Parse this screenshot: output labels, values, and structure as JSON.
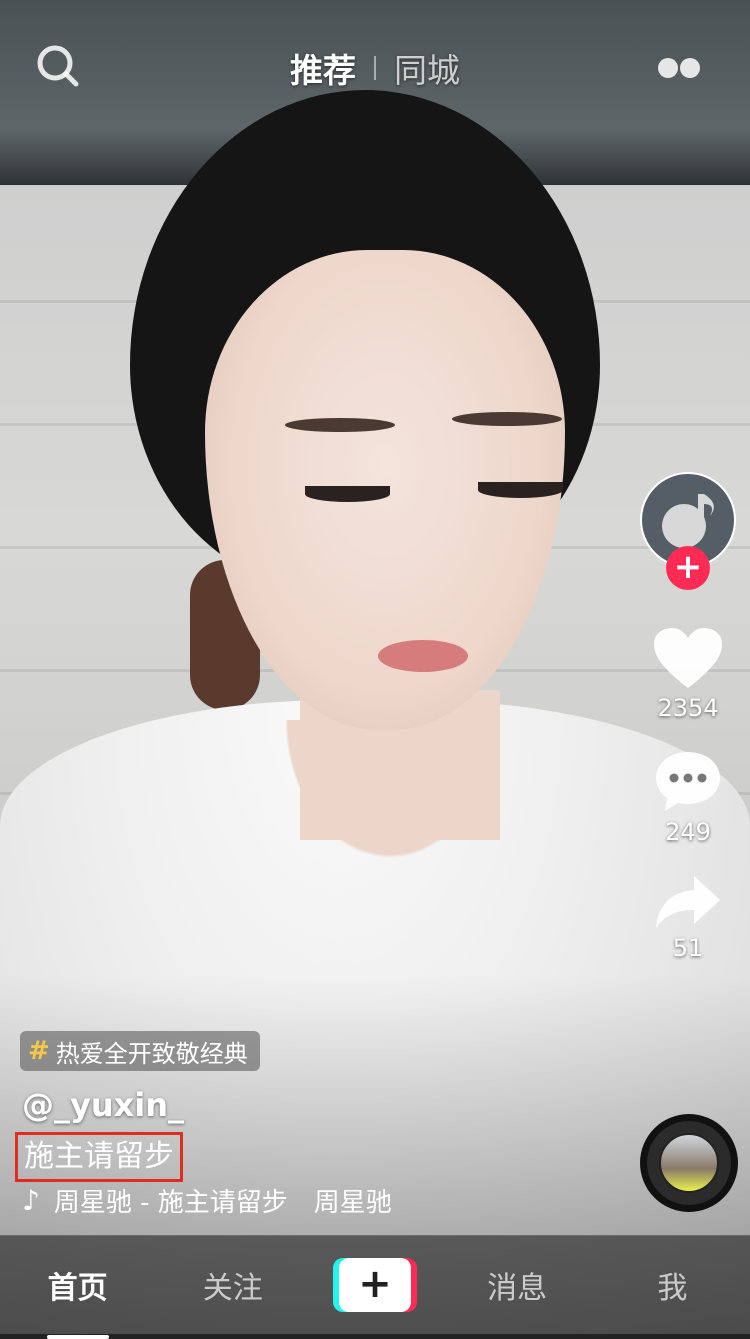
{
  "top": {
    "tab_recommend": "推荐",
    "tab_local": "同城",
    "search_icon": "search-icon",
    "live_icon": "live-dots-icon"
  },
  "rail": {
    "likes": "2354",
    "comments": "249",
    "shares": "51",
    "follow_label": "+"
  },
  "caption": {
    "hashtag": "热爱全开致敬经典",
    "username": "@_yuxin_",
    "text": "施主请留步",
    "music": "周星驰 - 施主请留步　周星驰"
  },
  "nav": {
    "home": "首页",
    "following": "关注",
    "add": "+",
    "messages": "消息",
    "me": "我"
  },
  "colors": {
    "accent_red": "#fe2c55",
    "accent_cyan": "#25f4ee",
    "hashtag_yellow": "#f7c746",
    "highlight_box": "#e02d22"
  }
}
